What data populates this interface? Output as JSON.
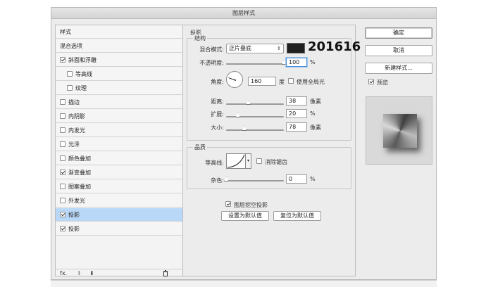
{
  "dialog": {
    "title": "图层样式"
  },
  "style_list": {
    "items": [
      {
        "label": "样式",
        "has_checkbox": false,
        "checked": false,
        "indent": 0,
        "plus": false,
        "selected": false
      },
      {
        "label": "混合选项",
        "has_checkbox": false,
        "checked": false,
        "indent": 0,
        "plus": false,
        "selected": false
      },
      {
        "label": "斜面和浮雕",
        "has_checkbox": true,
        "checked": true,
        "indent": 0,
        "plus": false,
        "selected": false
      },
      {
        "label": "等高线",
        "has_checkbox": true,
        "checked": false,
        "indent": 1,
        "plus": false,
        "selected": false
      },
      {
        "label": "纹理",
        "has_checkbox": true,
        "checked": false,
        "indent": 1,
        "plus": false,
        "selected": false
      },
      {
        "label": "描边",
        "has_checkbox": true,
        "checked": false,
        "indent": 0,
        "plus": true,
        "selected": false
      },
      {
        "label": "内阴影",
        "has_checkbox": true,
        "checked": false,
        "indent": 0,
        "plus": true,
        "selected": false
      },
      {
        "label": "内发光",
        "has_checkbox": true,
        "checked": false,
        "indent": 0,
        "plus": false,
        "selected": false
      },
      {
        "label": "光泽",
        "has_checkbox": true,
        "checked": false,
        "indent": 0,
        "plus": false,
        "selected": false
      },
      {
        "label": "颜色叠加",
        "has_checkbox": true,
        "checked": false,
        "indent": 0,
        "plus": true,
        "selected": false
      },
      {
        "label": "渐变叠加",
        "has_checkbox": true,
        "checked": true,
        "indent": 0,
        "plus": true,
        "selected": false
      },
      {
        "label": "图案叠加",
        "has_checkbox": true,
        "checked": false,
        "indent": 0,
        "plus": false,
        "selected": false
      },
      {
        "label": "外发光",
        "has_checkbox": true,
        "checked": false,
        "indent": 0,
        "plus": false,
        "selected": false
      },
      {
        "label": "投影",
        "has_checkbox": true,
        "checked": true,
        "indent": 0,
        "plus": true,
        "selected": true
      },
      {
        "label": "投影",
        "has_checkbox": true,
        "checked": true,
        "indent": 0,
        "plus": true,
        "selected": false
      }
    ],
    "footer": {
      "fx": "fx.",
      "up": "⬆",
      "down": "⬇",
      "trash": "🗑"
    }
  },
  "drop_shadow": {
    "section_title": "投影",
    "structure_title": "结构",
    "blend_mode_label": "混合模式:",
    "blend_mode_value": "正片叠底",
    "shadow_color": "#202020",
    "color_annotation": "201616",
    "opacity_label": "不透明度:",
    "opacity_value": "100",
    "opacity_unit": "%",
    "angle_label": "角度:",
    "angle_value": "160",
    "angle_unit": "度",
    "global_light_label": "使用全局光",
    "global_light_checked": false,
    "distance_label": "距离:",
    "distance_value": "38",
    "distance_unit": "像素",
    "spread_label": "扩展:",
    "spread_value": "20",
    "spread_unit": "%",
    "size_label": "大小:",
    "size_value": "78",
    "size_unit": "像素",
    "quality_title": "品质",
    "contour_label": "等高线:",
    "antialias_label": "消除锯齿",
    "antialias_checked": false,
    "noise_label": "杂色:",
    "noise_value": "0",
    "noise_unit": "%",
    "knockout_label": "图层挖空投影",
    "knockout_checked": true,
    "make_default_label": "设置为默认值",
    "reset_default_label": "复位为默认值",
    "sliders": {
      "opacity": 1.0,
      "distance": 0.38,
      "spread": 0.2,
      "size": 0.31,
      "noise": 0.0
    }
  },
  "actions": {
    "ok_label": "确定",
    "cancel_label": "取消",
    "new_style_label": "新建样式...",
    "preview_label": "预览",
    "preview_checked": true
  }
}
